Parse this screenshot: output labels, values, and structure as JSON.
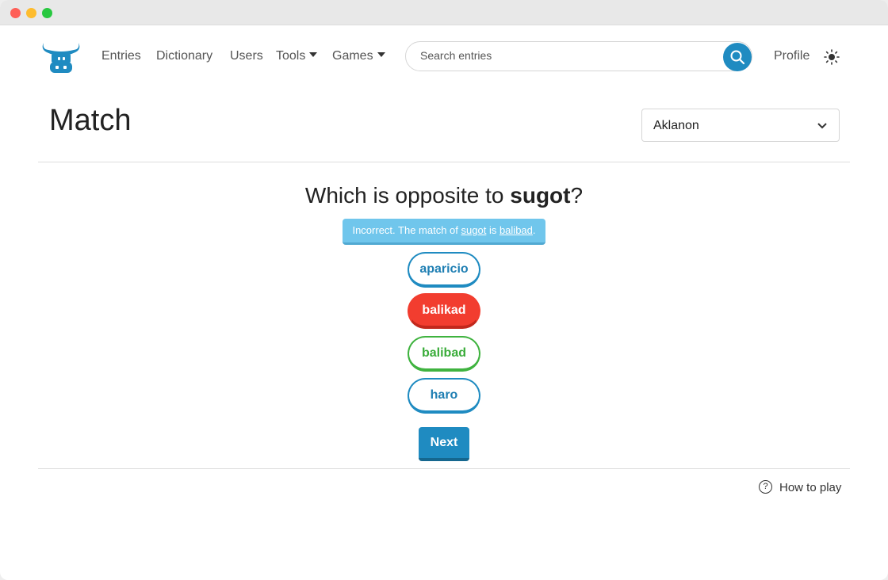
{
  "nav": {
    "links": [
      "Entries",
      "Dictionary",
      "Users",
      "Tools",
      "Games"
    ],
    "profile": "Profile"
  },
  "search": {
    "placeholder": "Search entries"
  },
  "page": {
    "title": "Match"
  },
  "language_select": {
    "value": "Aklanon"
  },
  "game": {
    "question": {
      "prefix": "Which is opposite to ",
      "word": "sugot",
      "suffix": "?"
    },
    "feedback": {
      "prefix": "Incorrect. The match of ",
      "word": "sugot",
      "middle": " is ",
      "answer": "balibad",
      "suffix": "."
    },
    "options": [
      {
        "label": "aparicio",
        "state": "neutral"
      },
      {
        "label": "balikad",
        "state": "wrong"
      },
      {
        "label": "balibad",
        "state": "correct"
      },
      {
        "label": "haro",
        "state": "neutral"
      }
    ],
    "next_label": "Next"
  },
  "footer": {
    "how_to_play": "How to play"
  },
  "colors": {
    "accent": "#1f8bc1",
    "wrong": "#f23d2f",
    "correct": "#3fb33f",
    "feedback": "#70c6ec"
  }
}
